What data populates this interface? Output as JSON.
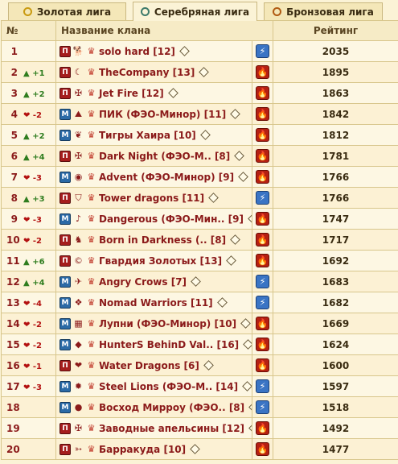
{
  "tabs": [
    {
      "label": "Золотая лига",
      "icon": "gold-league-icon",
      "color": "#c99a10",
      "active": false
    },
    {
      "label": "Серебряная лига",
      "icon": "silver-league-icon",
      "color": "#3d7a6a",
      "active": true
    },
    {
      "label": "Бронзовая лига",
      "icon": "bronze-league-icon",
      "color": "#b05a12",
      "active": false
    }
  ],
  "headers": {
    "num": "№",
    "name": "Название клана",
    "rating": "Рейтинг"
  },
  "colors": {
    "text": "#8b1a1a",
    "change_up": "#2f7d1f",
    "change_down": "#b31010",
    "background": "#fbf3d6"
  },
  "rows": [
    {
      "rank": "1",
      "change": "",
      "dir": "",
      "league": "П",
      "emblem": "🐕",
      "name": "solo hard [12]",
      "status": "bolt",
      "rating": "2035"
    },
    {
      "rank": "2",
      "change": "+1",
      "dir": "up",
      "league": "П",
      "emblem": "☾",
      "name": "TheCompany [13]",
      "status": "fire",
      "rating": "1895"
    },
    {
      "rank": "3",
      "change": "+2",
      "dir": "up",
      "league": "П",
      "emblem": "✠",
      "name": "Jet Fire [12]",
      "status": "fire",
      "rating": "1863"
    },
    {
      "rank": "4",
      "change": "-2",
      "dir": "down",
      "league": "М",
      "emblem": "⛰",
      "name": "ПИК (ФЭО-Минор) [11]",
      "status": "fire",
      "rating": "1842"
    },
    {
      "rank": "5",
      "change": "+2",
      "dir": "up",
      "league": "М",
      "emblem": "❦",
      "name": "Тигры Хаира [10]",
      "status": "fire",
      "rating": "1812"
    },
    {
      "rank": "6",
      "change": "+4",
      "dir": "up",
      "league": "П",
      "emblem": "✠",
      "name": "Dark Night (ФЭО-М.. [8]",
      "status": "fire",
      "rating": "1781"
    },
    {
      "rank": "7",
      "change": "-3",
      "dir": "down",
      "league": "М",
      "emblem": "◉",
      "name": "Advent (ФЭО-Минор) [9]",
      "status": "fire",
      "rating": "1766"
    },
    {
      "rank": "8",
      "change": "+3",
      "dir": "up",
      "league": "П",
      "emblem": "⛉",
      "name": "Tower dragons [11]",
      "status": "bolt",
      "rating": "1766"
    },
    {
      "rank": "9",
      "change": "-3",
      "dir": "down",
      "league": "М",
      "emblem": "♪",
      "name": "Dangerous (ФЭО-Мин.. [9]",
      "status": "fire",
      "rating": "1747"
    },
    {
      "rank": "10",
      "change": "-2",
      "dir": "down",
      "league": "П",
      "emblem": "♞",
      "name": "Born in Darkness (.. [8]",
      "status": "fire",
      "rating": "1717"
    },
    {
      "rank": "11",
      "change": "+6",
      "dir": "up",
      "league": "П",
      "emblem": "©",
      "name": "Гвардия Золотых  [13]",
      "status": "fire",
      "rating": "1692"
    },
    {
      "rank": "12",
      "change": "+4",
      "dir": "up",
      "league": "М",
      "emblem": "✈",
      "name": "Angry Crows [7]",
      "status": "bolt",
      "rating": "1683"
    },
    {
      "rank": "13",
      "change": "-4",
      "dir": "down",
      "league": "М",
      "emblem": "❖",
      "name": "Nomad Warriors [11]",
      "status": "bolt",
      "rating": "1682"
    },
    {
      "rank": "14",
      "change": "-2",
      "dir": "down",
      "league": "М",
      "emblem": "▦",
      "name": "Лупни (ФЭО-Минор) [10]",
      "status": "fire",
      "rating": "1669"
    },
    {
      "rank": "15",
      "change": "-2",
      "dir": "down",
      "league": "М",
      "emblem": "◆",
      "name": "HunterS BehinD Val.. [16]",
      "status": "fire",
      "rating": "1624"
    },
    {
      "rank": "16",
      "change": "-1",
      "dir": "down",
      "league": "П",
      "emblem": "❤",
      "name": "Water Dragons [6]",
      "status": "fire",
      "rating": "1600"
    },
    {
      "rank": "17",
      "change": "-3",
      "dir": "down",
      "league": "М",
      "emblem": "✹",
      "name": "Steel Lions (ФЭО-М.. [14]",
      "status": "bolt",
      "rating": "1597"
    },
    {
      "rank": "18",
      "change": "",
      "dir": "",
      "league": "М",
      "emblem": "●",
      "name": "Восход Мирроу (ФЭО.. [8]",
      "status": "bolt",
      "rating": "1518"
    },
    {
      "rank": "19",
      "change": "",
      "dir": "",
      "league": "П",
      "emblem": "✠",
      "name": "Заводные апельсины [12]",
      "status": "fire",
      "rating": "1492"
    },
    {
      "rank": "20",
      "change": "",
      "dir": "",
      "league": "П",
      "emblem": "➳",
      "name": "Барракуда [10]",
      "status": "fire",
      "rating": "1477"
    }
  ]
}
